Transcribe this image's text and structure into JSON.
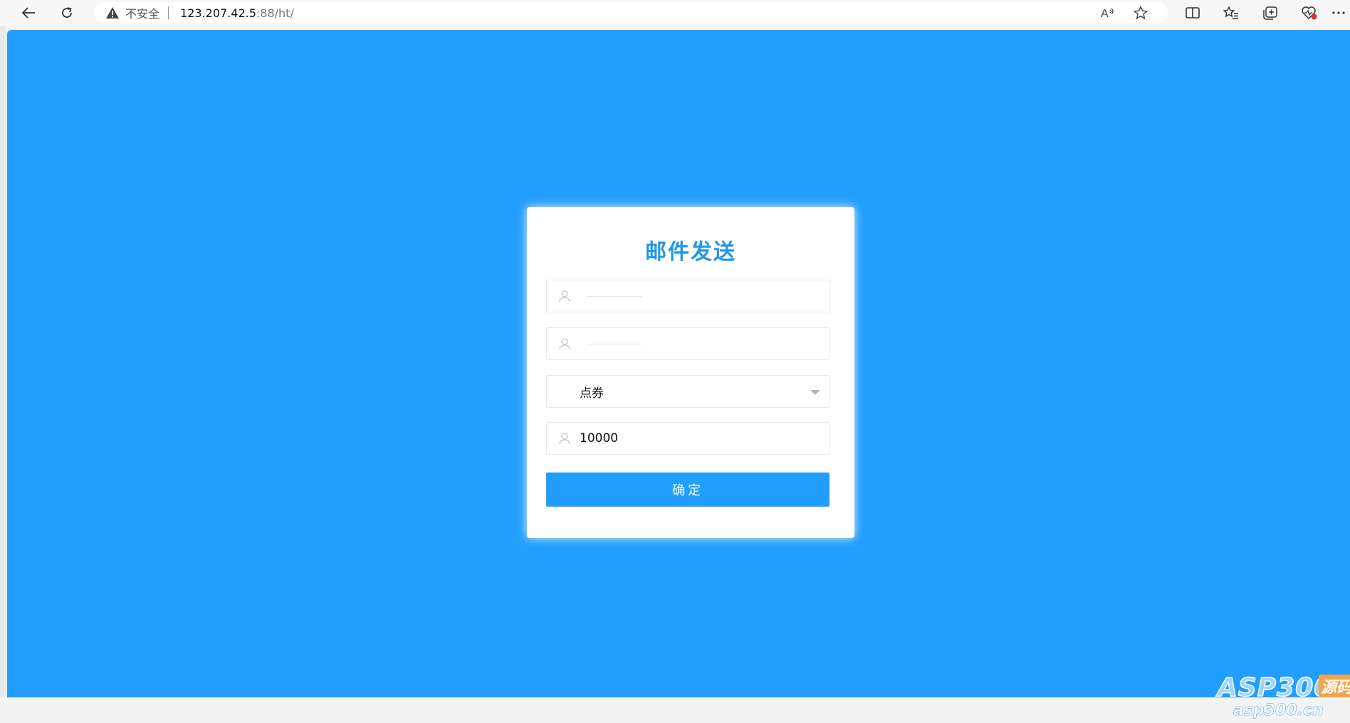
{
  "browser": {
    "security_label": "不安全",
    "url_host": "123.207.42.5",
    "url_rest": ":88/ht/",
    "icons": [
      "back-icon",
      "refresh-icon",
      "warning-icon",
      "read-aloud-icon",
      "favorite-star-icon",
      "split-screen-icon",
      "favorites-list-icon",
      "collections-icon",
      "browser-essentials-icon",
      "more-icon"
    ]
  },
  "form": {
    "title": "邮件发送",
    "fields": [
      {
        "placeholder": "",
        "value": ""
      },
      {
        "placeholder": "",
        "value": ""
      }
    ],
    "select": {
      "selected": "点券"
    },
    "amount": {
      "value": "10000"
    },
    "submit_label": "确定"
  },
  "watermark": {
    "brand": "ASP300",
    "badge": "源码",
    "url": "asp300.cn"
  },
  "colors": {
    "page_background": "#219efe",
    "title": "#2196ea",
    "button": "#219efe"
  }
}
